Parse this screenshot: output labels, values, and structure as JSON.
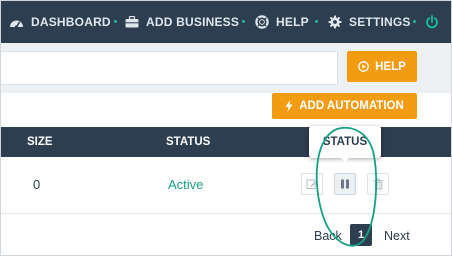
{
  "nav": {
    "items": [
      {
        "label": "DASHBOARD",
        "icon": "dashboard-icon"
      },
      {
        "label": "ADD BUSINESS",
        "icon": "briefcase-icon"
      },
      {
        "label": "HELP",
        "icon": "lifebuoy-icon"
      },
      {
        "label": "SETTINGS",
        "icon": "gear-icon"
      }
    ],
    "power_icon": "power-icon",
    "accent_color": "#1abc9c",
    "background_color": "#2c3e50"
  },
  "help_bar": {
    "button_label": "HELP",
    "button_icon": "play-circle-icon"
  },
  "toolbar": {
    "add_automation_label": "ADD AUTOMATION",
    "add_automation_icon": "bolt-icon",
    "button_color": "#f39c12"
  },
  "table": {
    "headers": {
      "size": "SIZE",
      "status": "STATUS"
    },
    "rows": [
      {
        "size": "0",
        "status": "Active",
        "actions": [
          "edit-icon",
          "pause-icon",
          "trash-icon"
        ]
      }
    ]
  },
  "tooltip": {
    "text": "STATUS"
  },
  "pagination": {
    "back": "Back",
    "current": "1",
    "next": "Next"
  },
  "annotation": {
    "shape": "ellipse",
    "color": "#16a085"
  }
}
